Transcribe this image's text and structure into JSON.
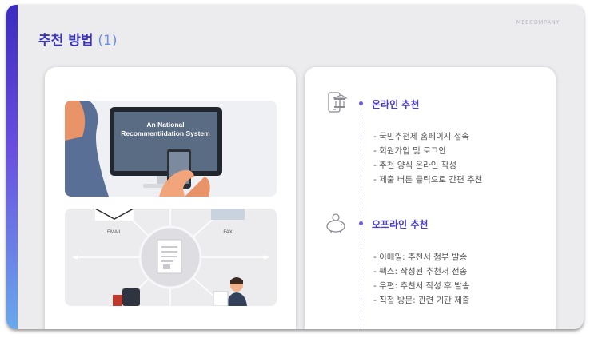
{
  "slide": {
    "brand": "MEECOMPANY",
    "title_main": "추천 방법 ",
    "title_num": "(1)"
  },
  "images": {
    "monitor_line1": "An National",
    "monitor_line2": "Recommentiidation System",
    "email_label": "EMAIL",
    "fax_label": "FAX"
  },
  "online": {
    "icon": "bank-phone-icon",
    "title": "온라인 추천",
    "items": [
      "- 국민추천제 홈페이지 접속",
      "- 회원가입 및 로그인",
      "- 추천 양식 온라인 작성",
      "- 제출 버튼 클릭으로 간편 추천"
    ]
  },
  "offline": {
    "icon": "piggy-bank-icon",
    "title": "오프라인 추천",
    "items": [
      "- 이메일: 추천서 첨부 발송",
      "- 팩스: 작성된 추천서 전송",
      "- 우편: 추천서 작성 후 발송",
      "- 직접 방문: 관련 기관 제출"
    ]
  },
  "colors": {
    "accent": "#3d35b8",
    "accent_light": "#6b8fe0",
    "dot": "#6b5be0"
  }
}
